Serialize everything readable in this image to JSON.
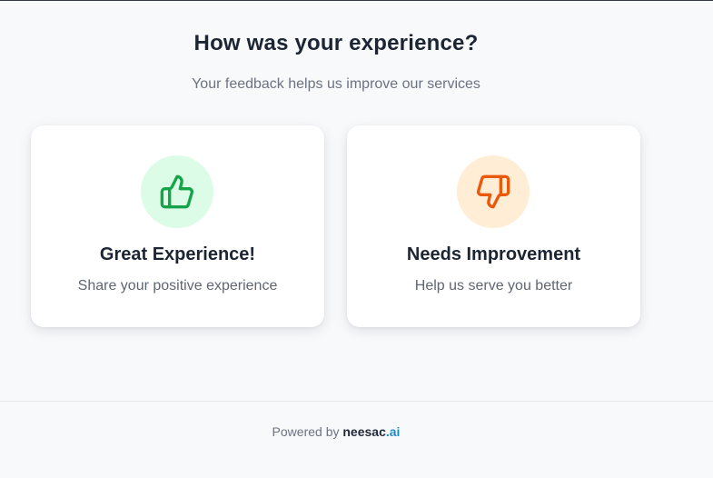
{
  "header": {
    "title": "How was your experience?",
    "subtitle": "Your feedback helps us improve our services"
  },
  "options": [
    {
      "title": "Great Experience!",
      "description": "Share your positive experience",
      "icon": "thumbs-up-icon",
      "icon_color": "#16a34a",
      "icon_bg": "#dcfce7"
    },
    {
      "title": "Needs Improvement",
      "description": "Help us serve you better",
      "icon": "thumbs-down-icon",
      "icon_color": "#ea580c",
      "icon_bg": "#ffedd5"
    }
  ],
  "footer": {
    "prefix": "Powered by",
    "brand_name": "neesac",
    "brand_tld": ".ai"
  },
  "colors": {
    "page_bg": "#f8f9fb",
    "text_dark": "#1c2533",
    "text_muted": "#6b7280",
    "brand_accent": "#1f8ac0"
  }
}
